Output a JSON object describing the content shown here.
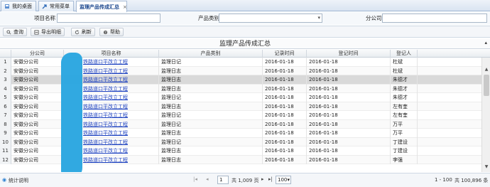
{
  "tabs": [
    {
      "label": "我的桌面",
      "icon": "home-icon"
    },
    {
      "label": "常用菜单",
      "icon": "arrow-icon"
    },
    {
      "label": "监理产品传成汇总",
      "icon": "",
      "close": "×"
    }
  ],
  "search": {
    "project_label": "项目名称",
    "project_value": "",
    "category_label": "产品类别",
    "category_value": "",
    "company_label": "分公司",
    "company_value": ""
  },
  "toolbar": {
    "query": "查询",
    "export": "导出明细",
    "refresh": "刷新",
    "help": "帮助"
  },
  "panel_title": "监理产品传成汇总",
  "columns": [
    "分公司",
    "项目名称",
    "产品类别",
    "记录时间",
    "登记时间",
    "登记人"
  ],
  "rows": [
    {
      "no": "1",
      "company": "安徽分公司",
      "project": "铁路道口平改立工程",
      "category": "监理日记",
      "record": "2016-01-18",
      "reg": "2016-01-18",
      "person": "杜斌"
    },
    {
      "no": "2",
      "company": "安徽分公司",
      "project": "铁路道口平改立工程",
      "category": "监理日志",
      "record": "2016-01-18",
      "reg": "2016-01-18",
      "person": "杜斌"
    },
    {
      "no": "3",
      "company": "安徽分公司",
      "project": "铁路道口平改立工程",
      "category": "监理日志",
      "record": "2016-01-18",
      "reg": "2016-01-18",
      "person": "朱德才"
    },
    {
      "no": "4",
      "company": "安徽分公司",
      "project": "铁路道口平改立工程",
      "category": "监理日志",
      "record": "2016-01-18",
      "reg": "2016-01-18",
      "person": "朱德才"
    },
    {
      "no": "5",
      "company": "安徽分公司",
      "project": "铁路道口平改立工程",
      "category": "监理日记",
      "record": "2016-01-18",
      "reg": "2016-01-18",
      "person": "朱德才"
    },
    {
      "no": "6",
      "company": "安徽分公司",
      "project": "铁路道口平改立工程",
      "category": "监理日志",
      "record": "2016-01-18",
      "reg": "2016-01-18",
      "person": "左有奎"
    },
    {
      "no": "7",
      "company": "安徽分公司",
      "project": "铁路道口平改立工程",
      "category": "监理日记",
      "record": "2016-01-18",
      "reg": "2016-01-18",
      "person": "左有奎"
    },
    {
      "no": "8",
      "company": "安徽分公司",
      "project": "铁路道口平改立工程",
      "category": "监理日记",
      "record": "2016-01-18",
      "reg": "2016-01-18",
      "person": "万平"
    },
    {
      "no": "9",
      "company": "安徽分公司",
      "project": "铁路道口平改立工程",
      "category": "监理日志",
      "record": "2016-01-18",
      "reg": "2016-01-18",
      "person": "万平"
    },
    {
      "no": "10",
      "company": "安徽分公司",
      "project": "铁路道口平改立工程",
      "category": "监理日记",
      "record": "2016-01-18",
      "reg": "2016-01-18",
      "person": "丁建设"
    },
    {
      "no": "11",
      "company": "安徽分公司",
      "project": "铁路道口平改立工程",
      "category": "监理日志",
      "record": "2016-01-18",
      "reg": "2016-01-18",
      "person": "丁建设"
    },
    {
      "no": "12",
      "company": "安徽分公司",
      "project": "铁路道口平改立工程",
      "category": "监理日志",
      "record": "2016-01-18",
      "reg": "2016-01-18",
      "person": "李强"
    }
  ],
  "selected_row": 3,
  "pager": {
    "stats_label": "统计说明",
    "page_value": "1",
    "total_pages": "共 1,009 页",
    "page_size": "100",
    "range": "1 - 100",
    "total": "共 100,896 条"
  },
  "colors": {
    "accent": "#15428b",
    "link": "#1a3fbf",
    "redaction": "#2aa6e0"
  }
}
